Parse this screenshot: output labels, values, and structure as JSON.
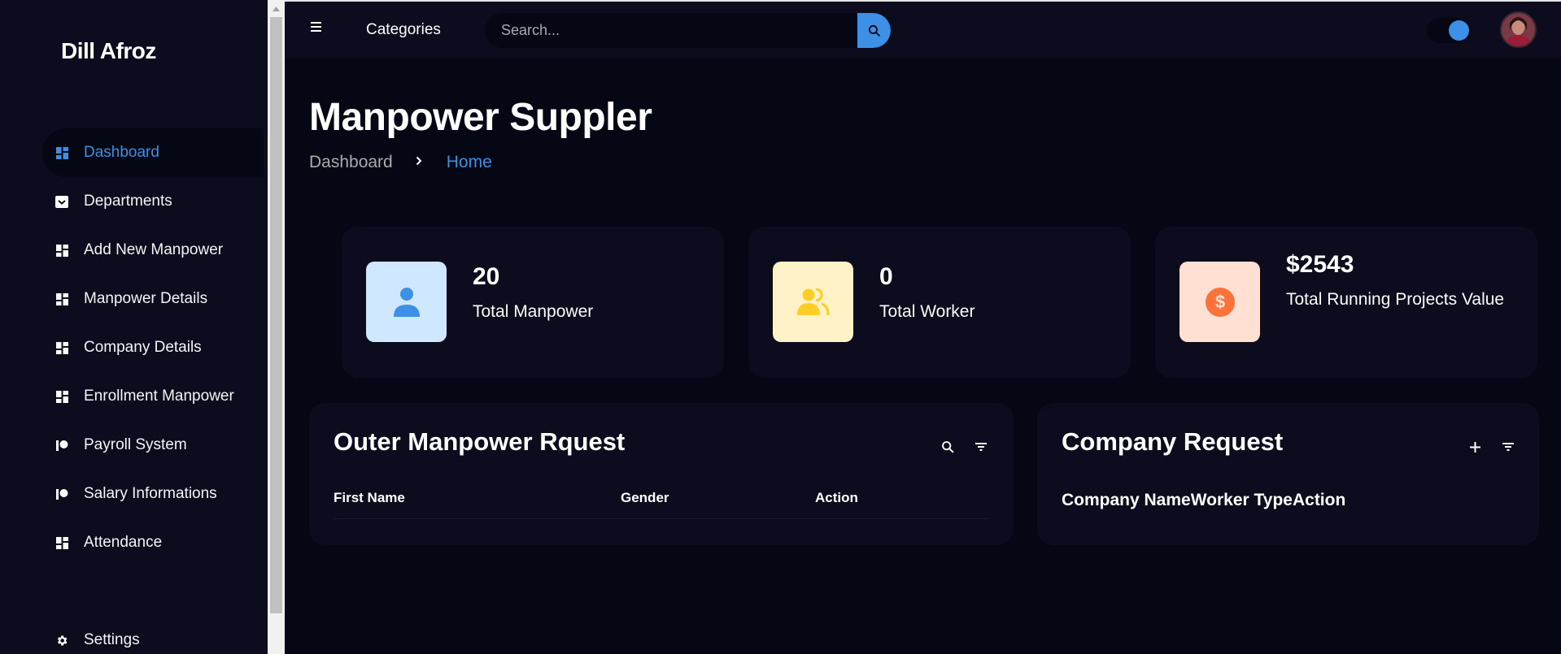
{
  "sidebar": {
    "brand": "Dill Afroz",
    "items": [
      {
        "label": "Dashboard",
        "icon": "dashboard-icon",
        "active": true
      },
      {
        "label": "Departments",
        "icon": "inbox-icon"
      },
      {
        "label": "Add New Manpower",
        "icon": "dashboard-icon"
      },
      {
        "label": "Manpower Details",
        "icon": "dashboard-icon"
      },
      {
        "label": "Company Details",
        "icon": "dashboard-icon"
      },
      {
        "label": "Enrollment Manpower",
        "icon": "dashboard-icon"
      },
      {
        "label": "Payroll System",
        "icon": "patreon-icon"
      },
      {
        "label": "Salary Informations",
        "icon": "patreon-icon"
      },
      {
        "label": "Attendance",
        "icon": "dashboard-icon"
      }
    ],
    "settings_label": "Settings"
  },
  "topbar": {
    "categories_label": "Categories",
    "search_placeholder": "Search...",
    "accent_color": "#3c91e6"
  },
  "main": {
    "title": "Manpower Suppler",
    "breadcrumb": {
      "parent": "Dashboard",
      "current": "Home"
    },
    "stats": [
      {
        "value": "20",
        "label": "Total Manpower",
        "icon": "user-icon",
        "icon_bg": "#cfe8ff",
        "icon_color": "#3c91e6"
      },
      {
        "value": "0",
        "label": "Total Worker",
        "icon": "group-icon",
        "icon_bg": "#fff2c6",
        "icon_color": "#ffce26"
      },
      {
        "value": "$2543",
        "label": "Total Running Projects Value",
        "icon": "dollar-circle-icon",
        "icon_bg": "#ffe0d3",
        "icon_color": "#fd7238"
      }
    ],
    "outer_request": {
      "title": "Outer Manpower Rquest",
      "columns": [
        "First Name",
        "Gender",
        "Action"
      ]
    },
    "company_request": {
      "title": "Company Request",
      "columns_text": "Company NameWorker TypeAction"
    }
  }
}
